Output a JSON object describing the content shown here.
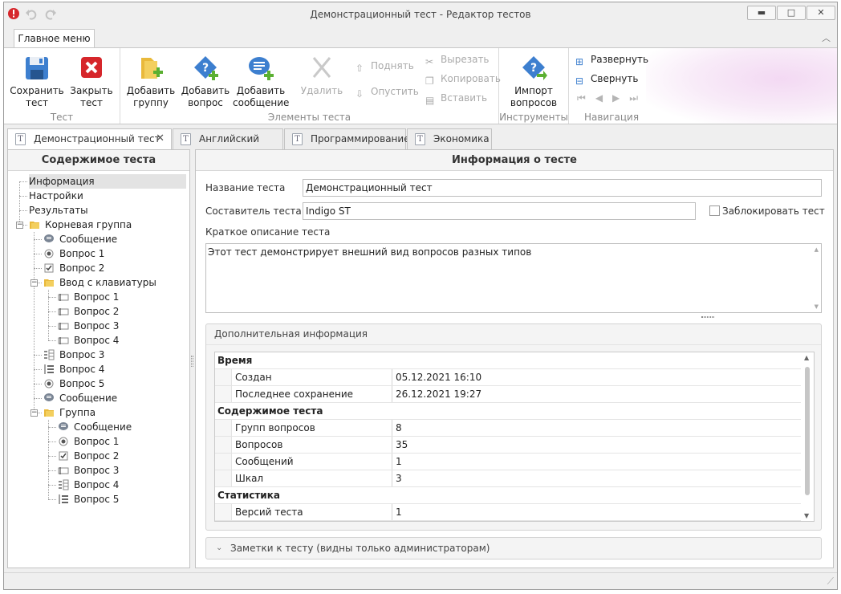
{
  "window": {
    "title": "Демонстрационный тест - Редактор тестов",
    "minimize": "▬",
    "maximize": "□",
    "close": "✕"
  },
  "ribbon": {
    "menu_tab": "Главное меню",
    "groups": {
      "test": "Тест",
      "elements": "Элементы теста",
      "tools": "Инструменты",
      "navigation": "Навигация"
    },
    "save": "Сохранить тест",
    "close": "Закрыть тест",
    "add_group": "Добавить группу",
    "add_question": "Добавить вопрос",
    "add_message": "Добавить сообщение",
    "delete": "Удалить",
    "move_up": "Поднять",
    "move_down": "Опустить",
    "cut": "Вырезать",
    "copy": "Копировать",
    "paste": "Вставить",
    "import": "Импорт вопросов",
    "expand": "Развернуть",
    "collapse": "Свернуть"
  },
  "tabs": [
    "Демонстрационный тест",
    "Английский язык",
    "Программирование",
    "Экономика"
  ],
  "left_panel": {
    "title": "Содержимое теста",
    "tree": [
      {
        "label": "Информация",
        "icon": "none"
      },
      {
        "label": "Настройки",
        "icon": "none"
      },
      {
        "label": "Результаты",
        "icon": "none"
      },
      {
        "label": "Корневая группа",
        "icon": "folder"
      },
      {
        "label": "Сообщение",
        "icon": "message"
      },
      {
        "label": "Вопрос 1",
        "icon": "radio"
      },
      {
        "label": "Вопрос 2",
        "icon": "checkbox"
      },
      {
        "label": "Ввод с клавиатуры",
        "icon": "folder"
      },
      {
        "label": "Вопрос 1",
        "icon": "text-input"
      },
      {
        "label": "Вопрос 2",
        "icon": "text-input"
      },
      {
        "label": "Вопрос 3",
        "icon": "text-input"
      },
      {
        "label": "Вопрос 4",
        "icon": "text-input"
      },
      {
        "label": "Вопрос 3",
        "icon": "matching"
      },
      {
        "label": "Вопрос 4",
        "icon": "ordering"
      },
      {
        "label": "Вопрос 5",
        "icon": "radio"
      },
      {
        "label": "Сообщение",
        "icon": "message"
      },
      {
        "label": "Группа",
        "icon": "folder"
      },
      {
        "label": "Сообщение",
        "icon": "message"
      },
      {
        "label": "Вопрос 1",
        "icon": "radio"
      },
      {
        "label": "Вопрос 2",
        "icon": "checkbox"
      },
      {
        "label": "Вопрос 3",
        "icon": "text-input"
      },
      {
        "label": "Вопрос 4",
        "icon": "matching"
      },
      {
        "label": "Вопрос 5",
        "icon": "ordering"
      }
    ]
  },
  "info": {
    "title": "Информация о тесте",
    "name_label": "Название теста",
    "name_value": "Демонстрационный тест",
    "author_label": "Составитель теста",
    "author_value": "Indigo ST",
    "lock_label": "Заблокировать тест",
    "desc_label": "Краткое описание теста",
    "desc_value": "Этот тест демонстрирует внешний вид вопросов разных типов",
    "extra_title": "Дополнительная информация",
    "grid": [
      {
        "cat": "Время"
      },
      {
        "k": "Создан",
        "v": "05.12.2021 16:10"
      },
      {
        "k": "Последнее сохранение",
        "v": "26.12.2021 19:27"
      },
      {
        "cat": "Содержимое теста"
      },
      {
        "k": "Групп вопросов",
        "v": "8"
      },
      {
        "k": "Вопросов",
        "v": "35"
      },
      {
        "k": "Сообщений",
        "v": "1"
      },
      {
        "k": "Шкал",
        "v": "3"
      },
      {
        "cat": "Статистика"
      },
      {
        "k": "Версий теста",
        "v": "1"
      }
    ],
    "notes_label": "Заметки к тесту (видны только администраторам)"
  },
  "colors": {
    "accent": "#0b6cc1",
    "close_red": "#d6262b",
    "folder": "#e9b93b",
    "add_green": "#5bb032"
  }
}
